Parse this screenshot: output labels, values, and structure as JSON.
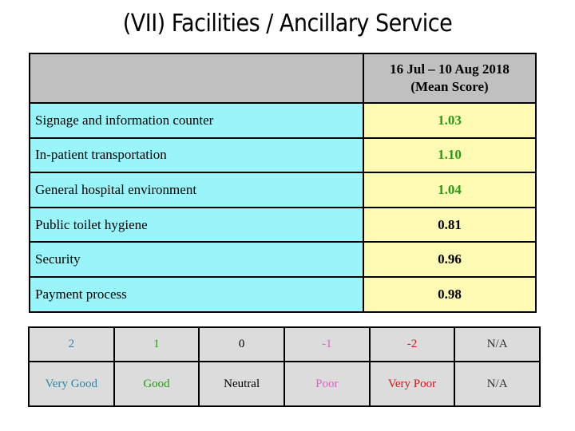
{
  "title": "(VII) Facilities / Ancillary Service",
  "table": {
    "period_line1": "16 Jul – 10 Aug 2018",
    "period_line2": "(Mean Score)",
    "rows": [
      {
        "label": "Signage and information counter",
        "value": "1.03",
        "color": "#2a9a14"
      },
      {
        "label": "In-patient transportation",
        "value": "1.10",
        "color": "#2a9a14"
      },
      {
        "label": "General hospital environment",
        "value": "1.04",
        "color": "#2a9a14"
      },
      {
        "label": "Public toilet hygiene",
        "value": "0.81",
        "color": "#000000"
      },
      {
        "label": "Security",
        "value": "0.96",
        "color": "#000000"
      },
      {
        "label": "Payment process",
        "value": "0.98",
        "color": "#000000"
      }
    ]
  },
  "legend": [
    {
      "score": "2",
      "label": "Very Good",
      "color": "#2e86a8"
    },
    {
      "score": "1",
      "label": "Good",
      "color": "#2a9a14"
    },
    {
      "score": "0",
      "label": "Neutral",
      "color": "#000000"
    },
    {
      "score": "-1",
      "label": "Poor",
      "color": "#e060c8"
    },
    {
      "score": "-2",
      "label": "Very Poor",
      "color": "#d01818"
    },
    {
      "score": "N/A",
      "label": "N/A",
      "color": "#333333"
    }
  ]
}
